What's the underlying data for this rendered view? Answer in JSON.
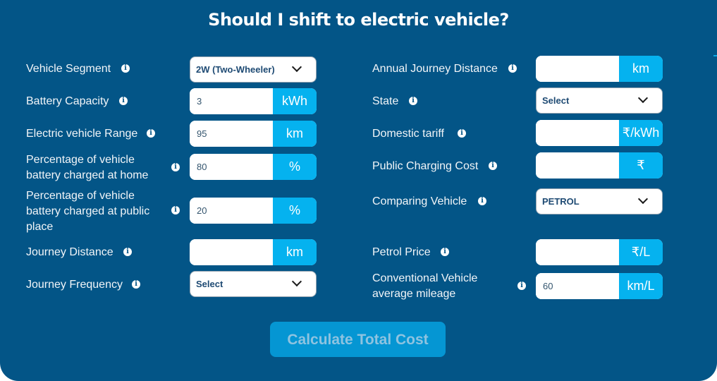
{
  "title": "Should I shift to electric vehicle?",
  "left_fields": [
    {
      "label": "Vehicle Segment",
      "type": "select",
      "value": "2W (Two-Wheeler)"
    },
    {
      "label": "Battery Capacity",
      "type": "input",
      "value": "3",
      "unit": "kWh"
    },
    {
      "label": "Electric vehicle Range",
      "type": "input",
      "value": "95",
      "unit": "km"
    },
    {
      "label_lines": [
        "Percentage of vehicle",
        "battery charged at home"
      ],
      "type": "input",
      "value": "80",
      "unit": "%"
    },
    {
      "label_lines": [
        "Percentage of vehicle",
        "battery charged at public",
        "place"
      ],
      "type": "input",
      "value": "20",
      "unit": "%"
    },
    {
      "label": "Journey Distance",
      "type": "input",
      "value": "",
      "unit": "km"
    },
    {
      "label": "Journey Frequency",
      "type": "select",
      "value": "Select"
    }
  ],
  "right_fields": [
    {
      "label": "Annual Journey Distance",
      "type": "input",
      "value": "",
      "unit": "km"
    },
    {
      "label": "State",
      "type": "select",
      "value": "Select"
    },
    {
      "label": "Domestic tariff",
      "type": "input",
      "value": "",
      "unit": "₹/kWh"
    },
    {
      "label": "Public Charging Cost",
      "type": "input",
      "value": "",
      "unit": "₹"
    },
    {
      "label": "Comparing Vehicle",
      "type": "select",
      "value": "PETROL"
    },
    {
      "label": "Petrol Price",
      "type": "input",
      "value": "",
      "unit": "₹/L"
    },
    {
      "label_lines": [
        "Conventional Vehicle",
        "average mileage"
      ],
      "type": "input",
      "value": "60",
      "unit": "km/L"
    }
  ],
  "info_icon_glyph": "i",
  "calculate_button": "Calculate Total Cost",
  "colors": {
    "background": "#035587",
    "accent": "#05b2ef",
    "button": "#0596d3",
    "button_text": "#8ec3e0"
  }
}
